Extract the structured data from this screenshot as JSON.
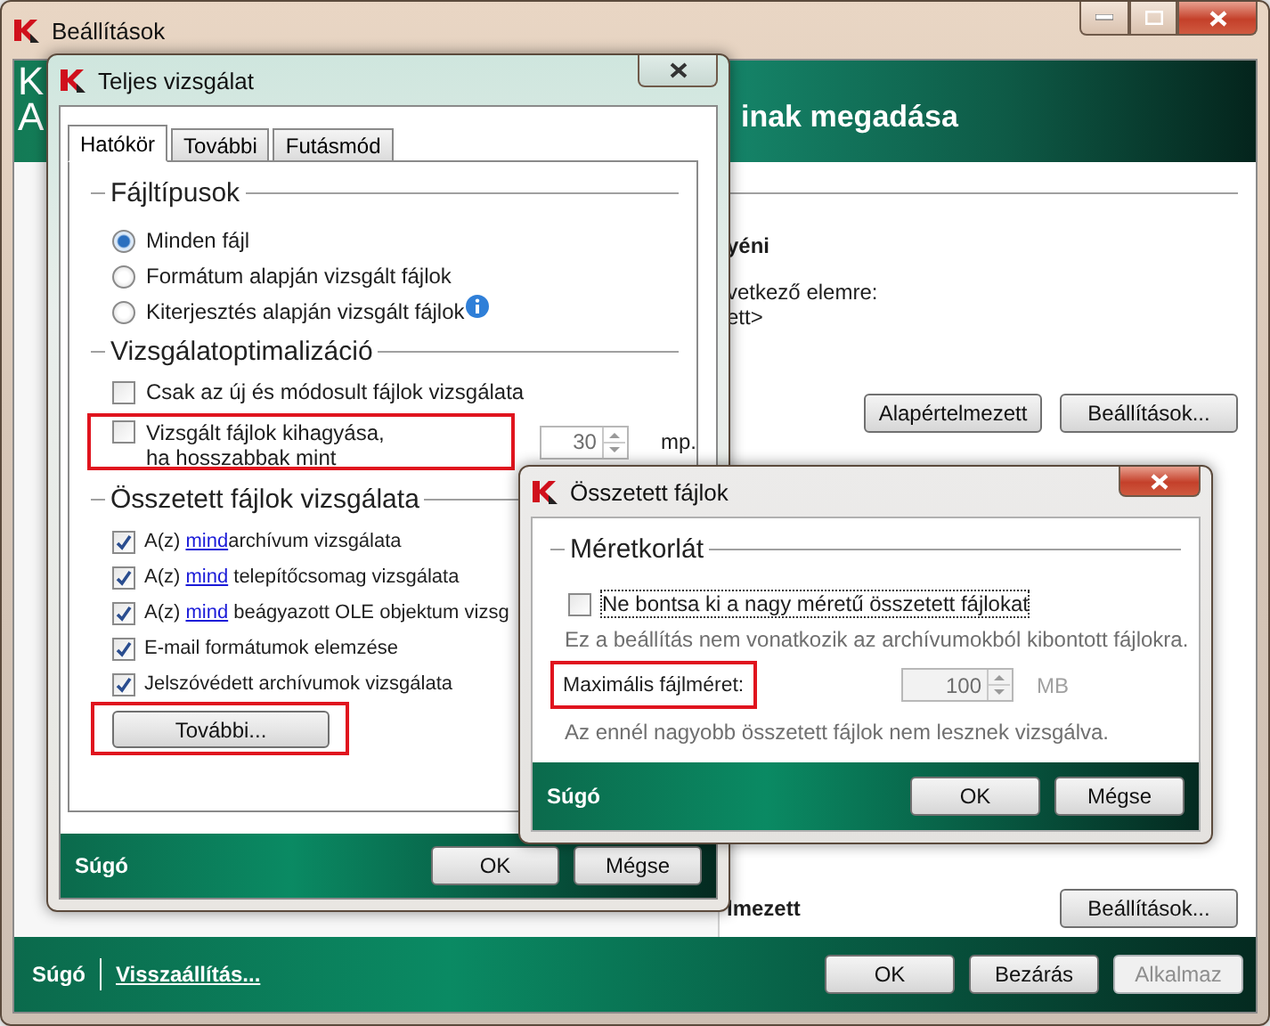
{
  "main_window": {
    "title": "Beállítások",
    "header": {
      "line_1": "K",
      "line_2_start": "A",
      "line_2_end": "inak megadása"
    },
    "content": {
      "heading": "yéni",
      "text_line_1": "vetkező elemre:",
      "text_line_2": "ett>",
      "buttons": [
        "Alapértelmezett",
        "Beállítások..."
      ],
      "lower_heading": "lmezett",
      "lower_button": "Beállítások..."
    },
    "footer": {
      "links": [
        "Súgó",
        "Visszaállítás..."
      ],
      "buttons": [
        {
          "label": "OK",
          "disabled": false
        },
        {
          "label": "Bezárás",
          "disabled": false
        },
        {
          "label": "Alkalmaz",
          "disabled": true
        }
      ]
    }
  },
  "scan_dialog": {
    "title": "Teljes vizsgálat",
    "tabs": [
      {
        "label": "Hatókör",
        "selected": true
      },
      {
        "label": "További",
        "selected": false
      },
      {
        "label": "Futásmód",
        "selected": false
      }
    ],
    "file_types": {
      "title": "Fájltípusok",
      "options": [
        {
          "label": "Minden fájl",
          "selected": true,
          "info": false
        },
        {
          "label": "Formátum alapján vizsgált fájlok",
          "selected": false,
          "info": false
        },
        {
          "label": "Kiterjesztés alapján vizsgált fájlok",
          "selected": false,
          "info": true
        }
      ]
    },
    "optimization": {
      "title": "Vizsgálatoptimalizáció",
      "items": [
        {
          "kind": "checkbox",
          "label_lines": [
            "Csak az új és módosult fájlok vizsgálata"
          ],
          "checked": false,
          "highlighted": false
        },
        {
          "kind": "checkbox_spinner",
          "label_lines": [
            "Vizsgált fájlok kihagyása,",
            "ha hosszabbak mint"
          ],
          "checked": false,
          "highlighted": true,
          "value": "30",
          "unit": "mp."
        }
      ]
    },
    "compound": {
      "title": "Összetett fájlok vizsgálata",
      "items": [
        {
          "prefix": "A(z)",
          "link": "mind",
          "rest": "archívum vizsgálata",
          "checked": true
        },
        {
          "prefix": "A(z)",
          "link": "mind",
          "rest": " telepítőcsomag vizsgálata",
          "checked": true
        },
        {
          "prefix": "A(z)",
          "link": "mind",
          "rest": " beágyazott OLE objektum vizsg",
          "checked": true
        },
        {
          "rest": "E-mail formátumok elemzése",
          "checked": true
        },
        {
          "rest": "Jelszóvédett archívumok vizsgálata",
          "checked": true
        }
      ],
      "button": {
        "label": "További...",
        "highlighted": true
      }
    },
    "footer": {
      "help": "Súgó",
      "buttons": [
        "OK",
        "Mégse"
      ]
    }
  },
  "compound_dialog": {
    "title": "Összetett fájlok",
    "group_title": "Méretkorlát",
    "checkbox": {
      "label": "Ne bontsa ki a nagy méretű összetett fájlokat",
      "checked": false,
      "focused": true
    },
    "hint_1": "Ez a beállítás nem vonatkozik az archívumokból kibontott fájlokra.",
    "size": {
      "label": "Maximális fájlméret:",
      "highlighted": true,
      "value": "100",
      "unit": "MB",
      "disabled": true
    },
    "hint_2": "Az ennél nagyobb összetett fájlok nem lesznek vizsgálva.",
    "footer": {
      "help": "Súgó",
      "buttons": [
        "OK",
        "Mégse"
      ]
    }
  }
}
